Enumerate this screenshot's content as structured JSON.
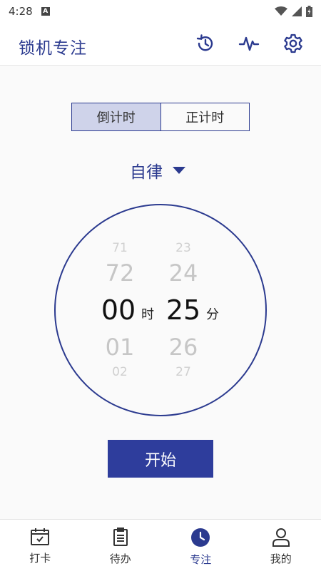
{
  "status_bar": {
    "time": "4:28",
    "notification_icon": "A"
  },
  "app_bar": {
    "title": "锁机专注",
    "icons": [
      "history-icon",
      "pulse-icon",
      "settings-icon"
    ]
  },
  "timer_mode": {
    "options": [
      "倒计时",
      "正计时"
    ],
    "selected": "倒计时"
  },
  "mode_select": {
    "label": "自律"
  },
  "picker": {
    "hours": {
      "far_above": "71",
      "above": "72",
      "selected": "00",
      "below": "01",
      "far_below": "02",
      "unit": "时"
    },
    "minutes": {
      "far_above": "23",
      "above": "24",
      "selected": "25",
      "below": "26",
      "far_below": "27",
      "unit": "分"
    }
  },
  "start_button": {
    "label": "开始"
  },
  "bottom_nav": {
    "items": [
      {
        "label": "打卡",
        "icon": "calendar-check-icon"
      },
      {
        "label": "待办",
        "icon": "clipboard-icon"
      },
      {
        "label": "专注",
        "icon": "clock-icon"
      },
      {
        "label": "我的",
        "icon": "person-icon"
      }
    ],
    "active": "专注"
  },
  "colors": {
    "primary": "#2b3a8f",
    "button": "#2e3d9c",
    "segment_active_bg": "#cfd3ea"
  }
}
